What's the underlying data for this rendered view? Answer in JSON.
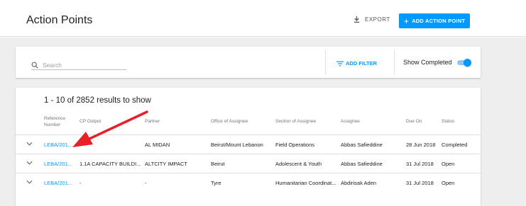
{
  "header": {
    "title": "Action Points",
    "export_label": "EXPORT",
    "add_label": "ADD ACTION POINT"
  },
  "filters": {
    "search_placeholder": "Search",
    "add_filter_label": "ADD FILTER",
    "show_completed_label": "Show Completed",
    "show_completed_on": true
  },
  "table": {
    "results_text": "1 - 10 of 2852 results to show",
    "columns": {
      "reference_line1": "Reference",
      "reference_line2": "Number",
      "cp_output": "CP Output",
      "partner": "Partner",
      "office": "Office of Assignee",
      "section": "Section of Assignee",
      "assignee": "Assignee",
      "due_on": "Due On",
      "status": "Status"
    },
    "rows": [
      {
        "reference": "LEBA/201...",
        "cp_output": "",
        "partner": "AL MIDAN",
        "office": "Beirut/Mount Lebanon",
        "section": "Field Operations",
        "assignee": "Abbas Safieddine",
        "due_on": "28 Jun 2018",
        "status": "Completed"
      },
      {
        "reference": "LEBA/201...",
        "cp_output": "1.1A CAPACITY BUILDI...",
        "partner": "ALTCITY IMPACT",
        "office": "Beirut",
        "section": "Adolescent & Youth",
        "assignee": "Abbas Safieddine",
        "due_on": "31 Jul 2018",
        "status": "Open"
      },
      {
        "reference": "LEBA/201...",
        "cp_output": "-",
        "partner": "-",
        "office": "Tyre",
        "section": "Humanitarian Coordinat...",
        "assignee": "Abdirisak Aden",
        "due_on": "31 Jul 2018",
        "status": "Open"
      }
    ]
  },
  "colors": {
    "accent": "#0099ff",
    "annotation_arrow": "#e8202a"
  },
  "icons": {
    "export": "download-icon",
    "add": "plus-icon",
    "search": "search-icon",
    "filter": "filter-list-icon",
    "expand": "chevron-down-icon"
  }
}
